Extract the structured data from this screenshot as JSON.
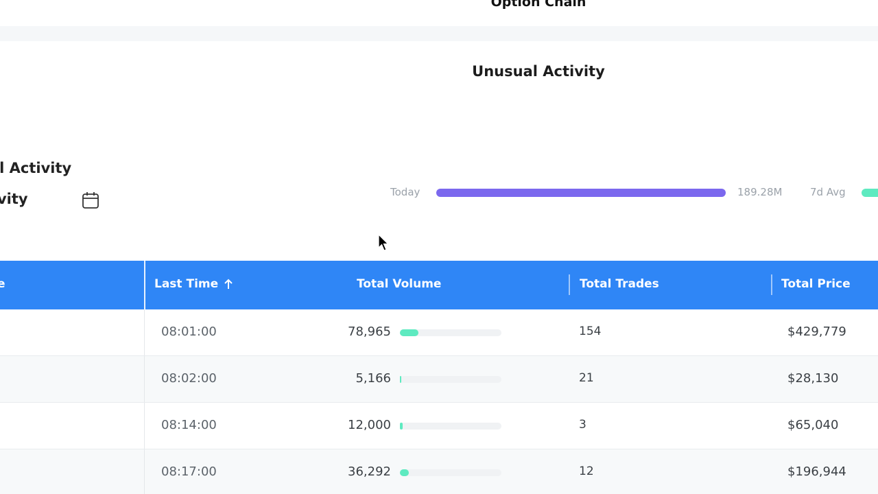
{
  "header": {
    "option_chain_title": "Option Chain",
    "unusual_activity_title": "Unusual Activity"
  },
  "left_panel": {
    "title_line_1": "ual Activity",
    "title_line_2": "Activity",
    "calendar_icon": "calendar-icon"
  },
  "volume_summary": {
    "today_label": "Today",
    "today_value": "189.28M",
    "avg_label": "7d Avg",
    "today_bar_color": "#7b68ee",
    "avg_bar_color": "#5eeac0"
  },
  "table": {
    "header_color": "#2f86f6",
    "columns": {
      "cut_col": "e",
      "last_time": "Last Time",
      "total_volume": "Total Volume",
      "total_trades": "Total Trades",
      "total_price": "Total Price"
    },
    "sort_icon": "arrow-up-icon",
    "rows": [
      {
        "time": "08:01:00",
        "volume": "78,965",
        "volume_fraction": 0.18,
        "trades": "154",
        "price": "$429,779"
      },
      {
        "time": "08:02:00",
        "volume": "5,166",
        "volume_fraction": 0.015,
        "trades": "21",
        "price": "$28,130"
      },
      {
        "time": "08:14:00",
        "volume": "12,000",
        "volume_fraction": 0.03,
        "trades": "3",
        "price": "$65,040"
      },
      {
        "time": "08:17:00",
        "volume": "36,292",
        "volume_fraction": 0.085,
        "trades": "12",
        "price": "$196,944"
      }
    ]
  }
}
